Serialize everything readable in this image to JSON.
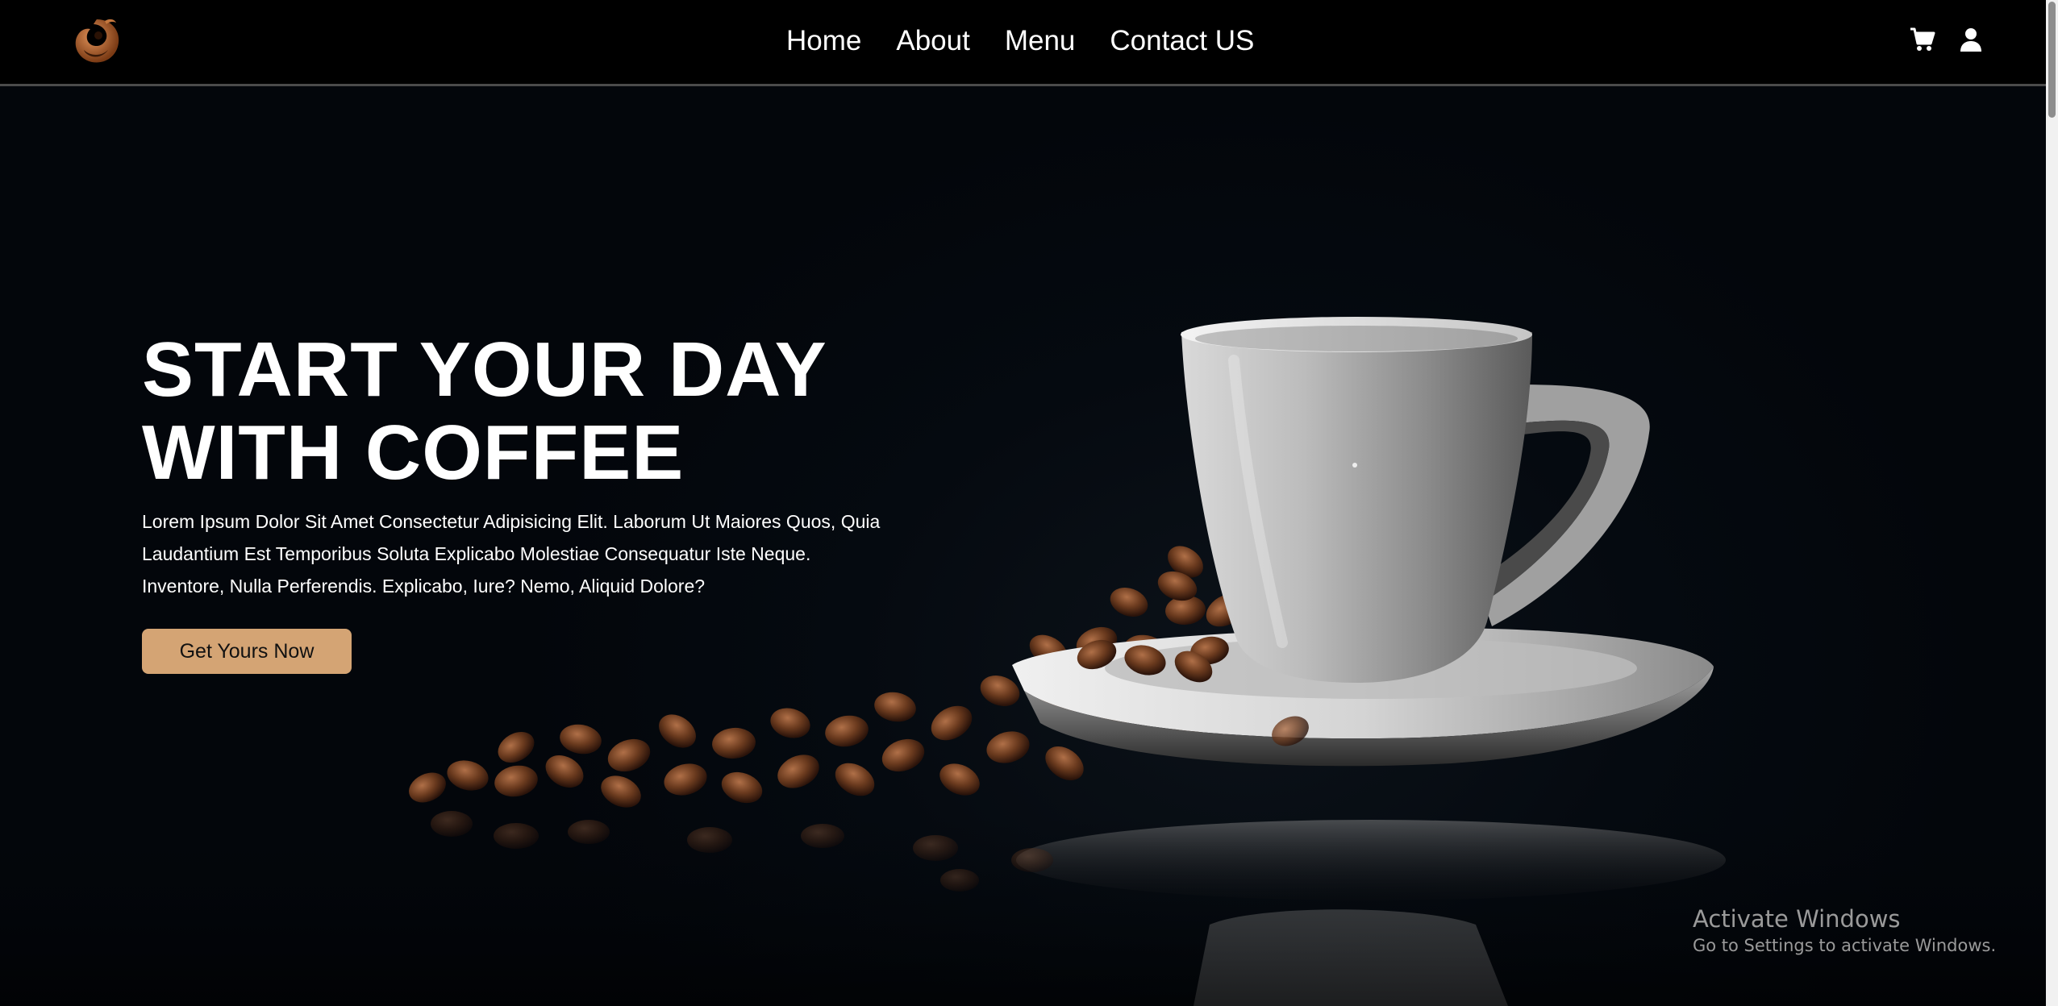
{
  "nav": {
    "logo_icon": "coffee-swirl-logo",
    "links": [
      {
        "label": "Home"
      },
      {
        "label": "About"
      },
      {
        "label": "Menu"
      },
      {
        "label": "Contact US"
      }
    ],
    "icons": [
      "cart-icon",
      "user-icon"
    ]
  },
  "hero": {
    "title_line1": "START YOUR DAY",
    "title_line2": "WITH COFFEE",
    "text_line1": "Lorem Ipsum Dolor Sit Amet Consectetur Adipisicing Elit. Laborum Ut Maiores Quos, Quia",
    "text_line2": "Laudantium Est Temporibus Soluta Explicabo Molestiae Consequatur Iste Neque.",
    "text_line3": "Inventore, Nulla Perferendis. Explicabo, Iure? Nemo, Aliquid Dolore?",
    "cta_label": "Get Yours Now",
    "image_icon": "coffee-cup-with-beans-photo"
  },
  "watermark": {
    "title": "Activate Windows",
    "subtitle": "Go to Settings to activate Windows."
  },
  "colors": {
    "navbar_bg": "#000000",
    "hero_bg": "#03060b",
    "cta_bg": "#d4a474",
    "text": "#ffffff"
  }
}
